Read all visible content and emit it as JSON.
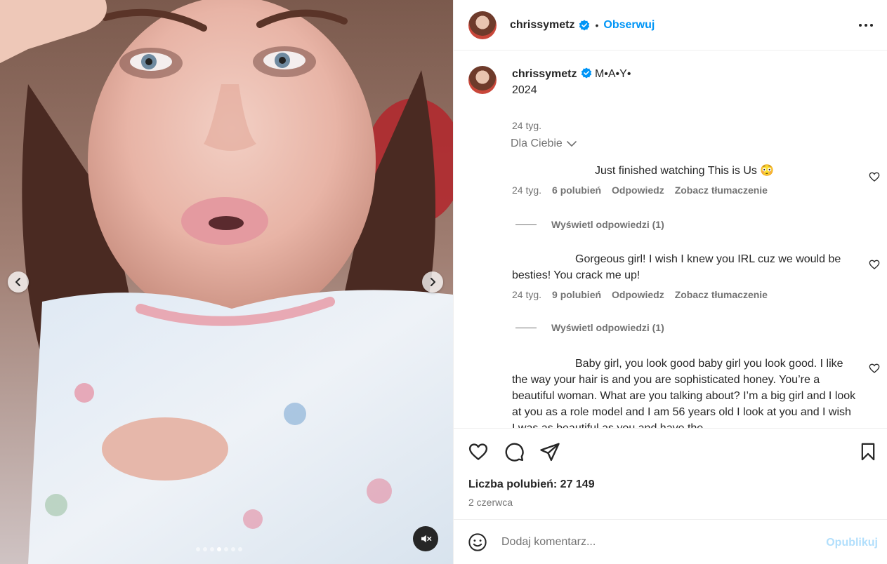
{
  "post": {
    "username": "chrissymetz",
    "follow_label": "Obserwuj",
    "separator": "•"
  },
  "caption": {
    "username": "chrissymetz",
    "text_line1": "M•A•Y•",
    "text_line2": "2024",
    "time": "24 tyg."
  },
  "filter": {
    "label": "Dla Ciebie"
  },
  "comments": [
    {
      "text": "Just finished watching This is Us 😳",
      "time": "24 tyg.",
      "likes": "6 polubień",
      "reply": "Odpowiedz",
      "translate": "Zobacz tłumaczenie",
      "view_replies": "Wyświetl odpowiedzi (1)"
    },
    {
      "text": "Gorgeous girl! I wish I knew you IRL cuz we would be besties! You crack me up!",
      "time": "24 tyg.",
      "likes": "9 polubień",
      "reply": "Odpowiedz",
      "translate": "Zobacz tłumaczenie",
      "view_replies": "Wyświetl odpowiedzi (1)"
    },
    {
      "text": "Baby girl, you look good baby girl you look good. I like the way your hair is and you are sophisticated honey. You’re a beautiful woman. What are you talking about? I’m a big girl and I look at you as a role model and I am 56 years old I look at you and I wish I was as beautiful as you and have the"
    }
  ],
  "engagement": {
    "likes_label": "Liczba polubień: 27 149",
    "date": "2 czerwca"
  },
  "comment_box": {
    "placeholder": "Dodaj komentarz...",
    "publish_label": "Opublikuj"
  },
  "carousel": {
    "count": 7,
    "active_index": 3
  },
  "colors": {
    "accent": "#0095f6",
    "verified": "#0095f6",
    "publish_disabled": "#b2dffc"
  },
  "icons": [
    "chevron-left-icon",
    "chevron-right-icon",
    "mute-icon",
    "more-icon",
    "verified-icon",
    "heart-icon",
    "comment-icon",
    "share-icon",
    "bookmark-icon",
    "emoji-icon",
    "chevron-down-icon"
  ]
}
